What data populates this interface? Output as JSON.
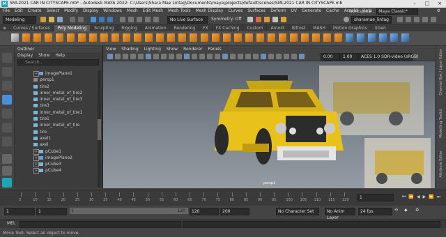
{
  "app": {
    "window_title": "SML2021 CAR IN CITYSCAPE.mb* - Autodesk MAYA 2022: C:\\Users\\Shara Mae Lintag\\Documents\\maya\\projects\\default\\scenes\\SML2021 CAR IN CITYSCAPE.mb",
    "logo": "M",
    "menu": [
      "File",
      "Edit",
      "Create",
      "Select",
      "Modify",
      "Display",
      "Windows",
      "Mesh",
      "Edit Mesh",
      "Mesh Tools",
      "Mesh Display",
      "Curves",
      "Surfaces",
      "Deform",
      "UV",
      "Generate",
      "Cache",
      "Arnold",
      "Help"
    ],
    "workspace_label": "Workspace :",
    "workspace_value": "Maya Classic*"
  },
  "status_line": {
    "menuset": "Modeling",
    "live_surface": "No Live Surface",
    "symmetry": "Symmetry: Off",
    "user": "sharamae_lintag"
  },
  "shelf_tabs": [
    "Curves / Surfaces",
    "Poly Modeling",
    "Sculpting",
    "Rigging",
    "Animation",
    "Rendering",
    "FX",
    "FX Caching",
    "Custom",
    "Arnold",
    "Bifrost",
    "MASH",
    "Motion Graphics",
    "XGen"
  ],
  "shelf_active": "Poly Modeling",
  "outliner": {
    "title": "Outliner",
    "menu": [
      "Display",
      "Show",
      "Help"
    ],
    "search_placeholder": "Search...",
    "items": [
      "imagePlane1",
      "persp1",
      "tire2",
      "inner_metal_of_tire2",
      "inner_metal_of_tire3",
      "tire3",
      "inner_metal_of_tire1",
      "tire1",
      "inner_metal_of_tire",
      "tire",
      "axel1",
      "axel",
      "pCube1",
      "imagePlane2",
      "pCube3",
      "pCube4"
    ]
  },
  "viewport": {
    "menu": [
      "View",
      "Shading",
      "Lighting",
      "Show",
      "Renderer",
      "Panels"
    ],
    "field1": "0.00",
    "field2": "1.00",
    "colorspace": "ACES 1.0 SDR-video (sRGB)",
    "camera": "persp1"
  },
  "side_tabs": [
    "Channel Box / Layer Editor",
    "Modelling Toolkit",
    "Attribute Editor"
  ],
  "timeline": {
    "ticks": [
      "5",
      "10",
      "15",
      "20",
      "25",
      "30",
      "35",
      "40",
      "45",
      "50",
      "55",
      "60",
      "65",
      "70",
      "75",
      "80",
      "85",
      "90",
      "95",
      "100",
      "105",
      "110",
      "115",
      "120"
    ],
    "current_frame": "1"
  },
  "range": {
    "start": "1",
    "anim_start": "1",
    "slider_start": "1",
    "slider_end": "120",
    "end": "120",
    "anim_end": "200",
    "character_set": "No Character Set",
    "anim_layer": "No Anim Layer",
    "fps": "24 fps"
  },
  "command_line": {
    "label": "MEL"
  },
  "help_line": "Move Tool: Select an object to move.",
  "colors": {
    "accent_blue": "#4a90d9",
    "shelf_orange": "#f2a33a",
    "taxi_yellow": "#e8c21a"
  }
}
